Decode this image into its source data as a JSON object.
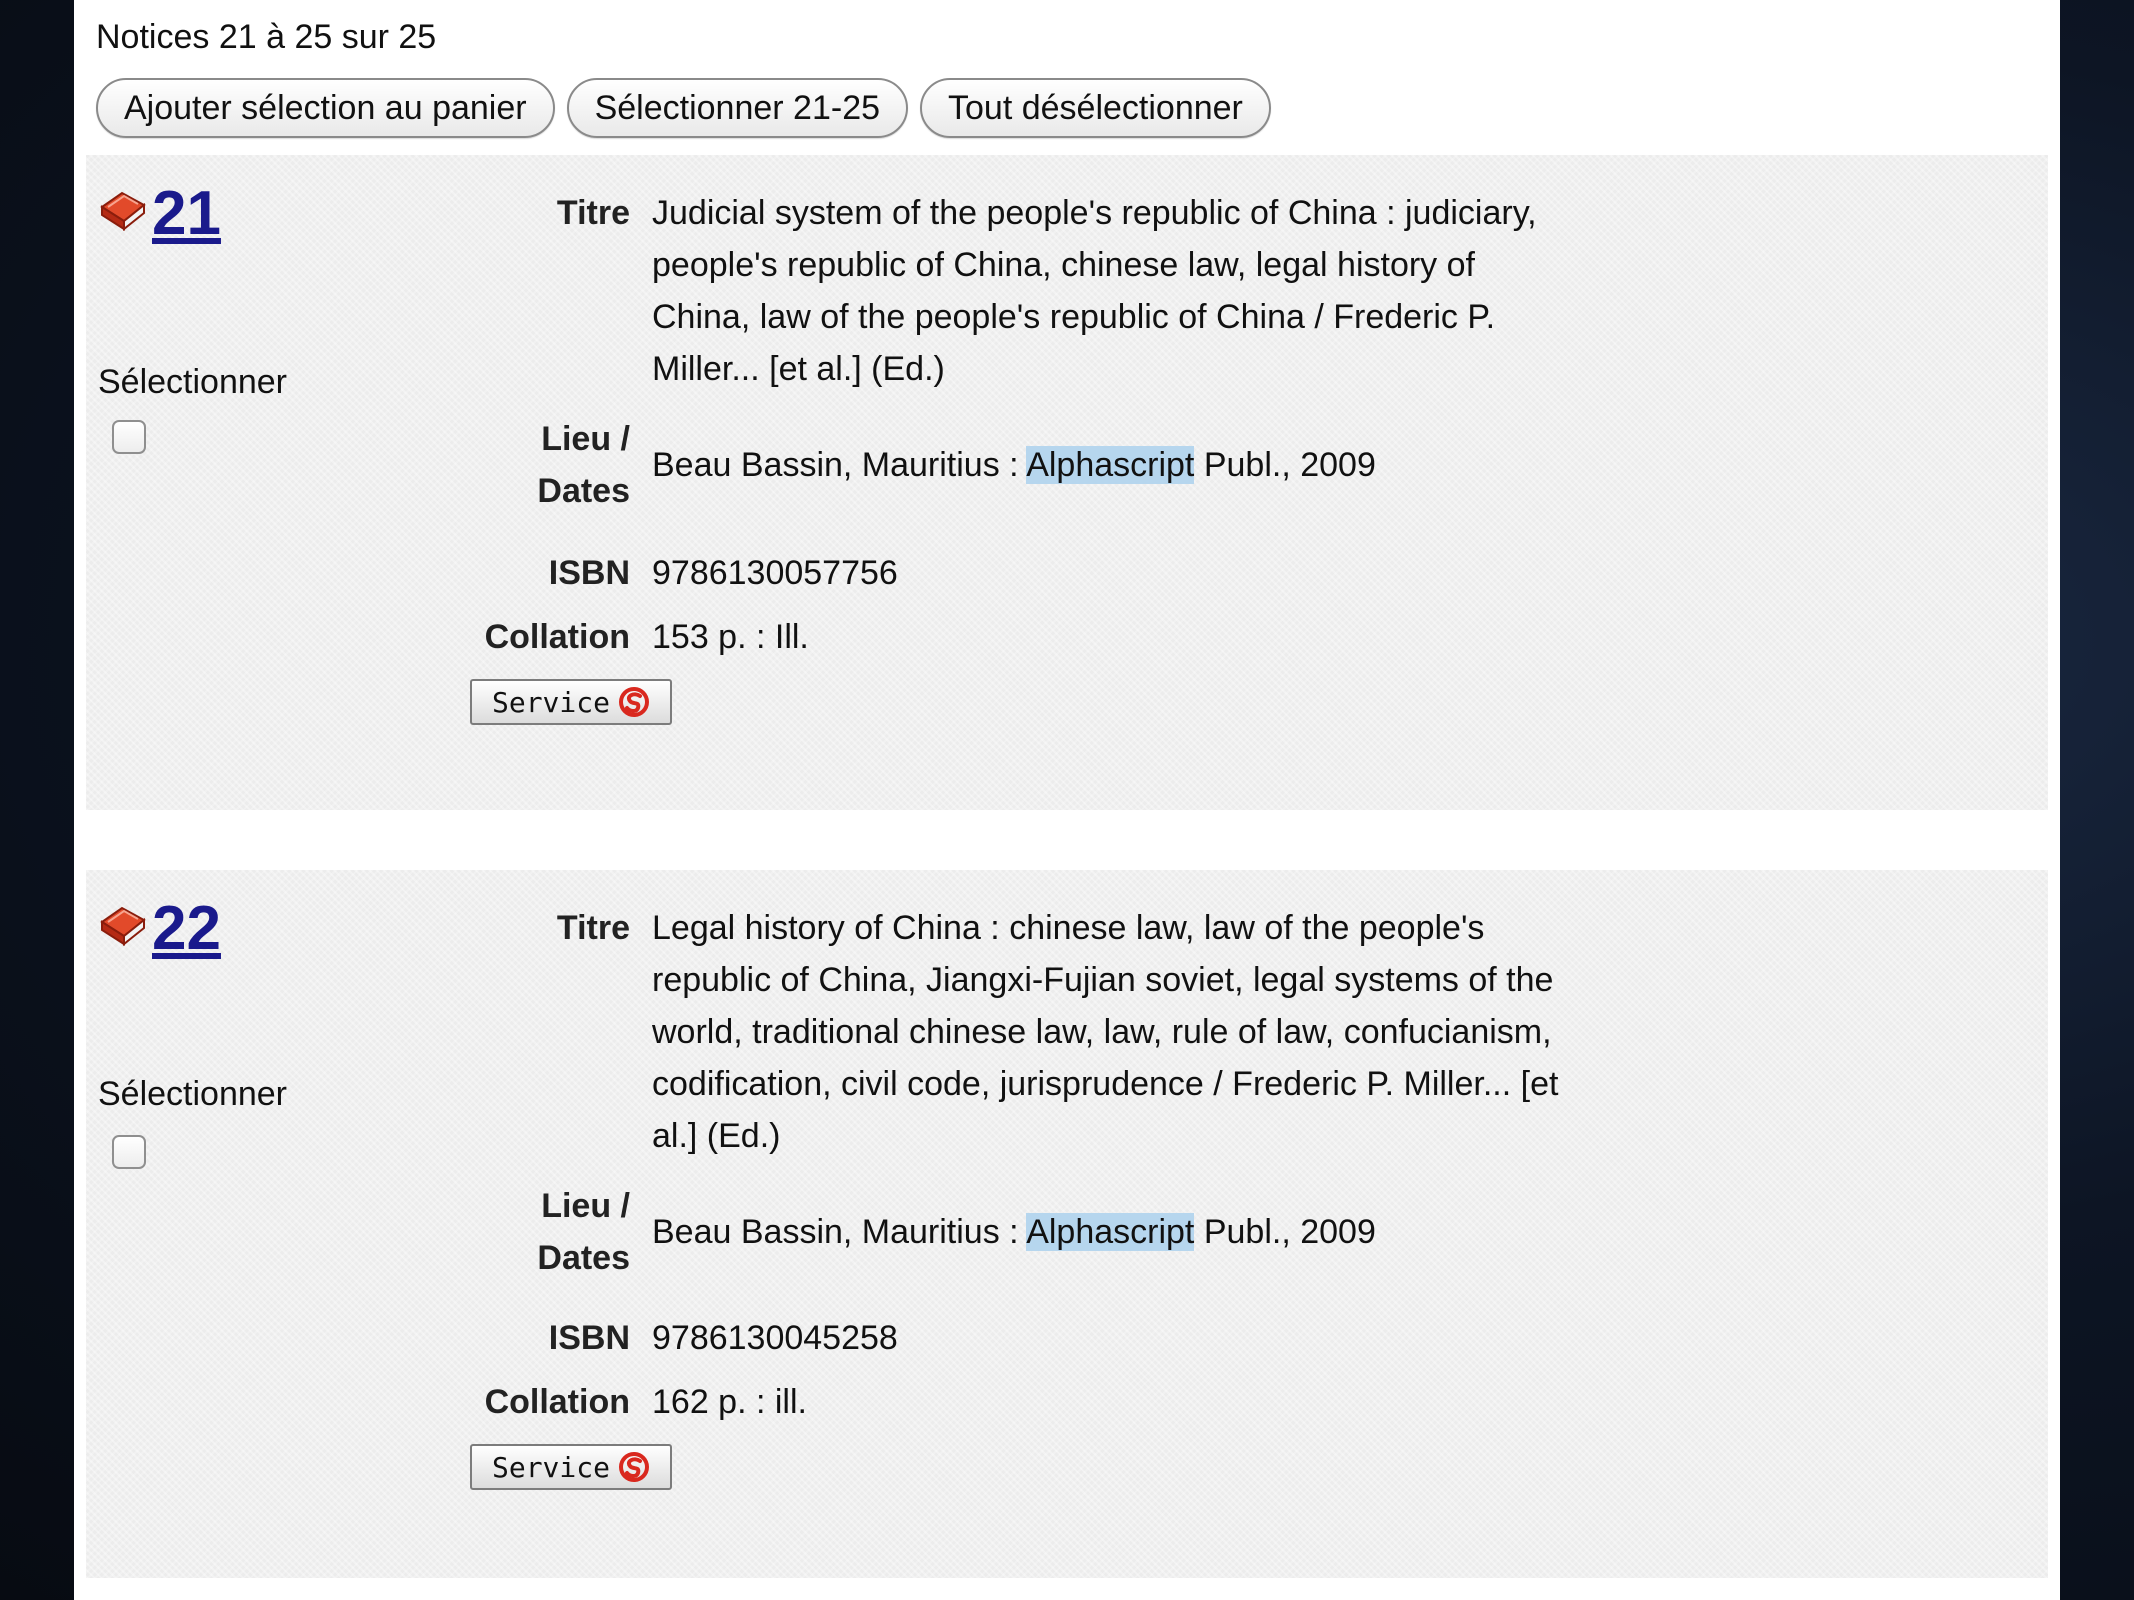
{
  "header": {
    "count_text": "Notices 21 à 25 sur 25"
  },
  "toolbar": {
    "add_to_cart": "Ajouter sélection au panier",
    "select_range": "Sélectionner 21-25",
    "deselect_all": "Tout désélectionner"
  },
  "labels": {
    "select": "Sélectionner",
    "title": "Titre",
    "place_line1": "Lieu /",
    "place_line2": "Dates",
    "isbn": "ISBN",
    "collation": "Collation",
    "service": "Service"
  },
  "records": [
    {
      "number": "21",
      "title": "Judicial system of the people's republic of China : judiciary, people's republic of China, chinese law, legal history of China, law of the people's republic of China / Frederic P. Miller... [et al.] (Ed.)",
      "place_before": "Beau Bassin, Mauritius : ",
      "place_highlight": "Alphascript",
      "place_after": " Publ., 2009",
      "isbn": "9786130057756",
      "collation": "153 p. : Ill."
    },
    {
      "number": "22",
      "title": "Legal history of China : chinese law, law of the people's republic of China, Jiangxi-Fujian soviet, legal systems of the world, traditional chinese law, law, rule of law, confucianism, codification, civil code, jurisprudence / Frederic P. Miller... [et al.] (Ed.)",
      "place_before": "Beau Bassin, Mauritius : ",
      "place_highlight": "Alphascript",
      "place_after": " Publ., 2009",
      "isbn": "9786130045258",
      "collation": "162 p. : ill."
    }
  ],
  "colors": {
    "record_link": "#1a1a8c",
    "highlight": "#b6d6ee",
    "record_bg": "#ececec",
    "book_icon": "#d9381e",
    "service_icon": "#d9281e"
  },
  "icons": {
    "record_type": "book-icon",
    "service": "service-logo-icon"
  }
}
